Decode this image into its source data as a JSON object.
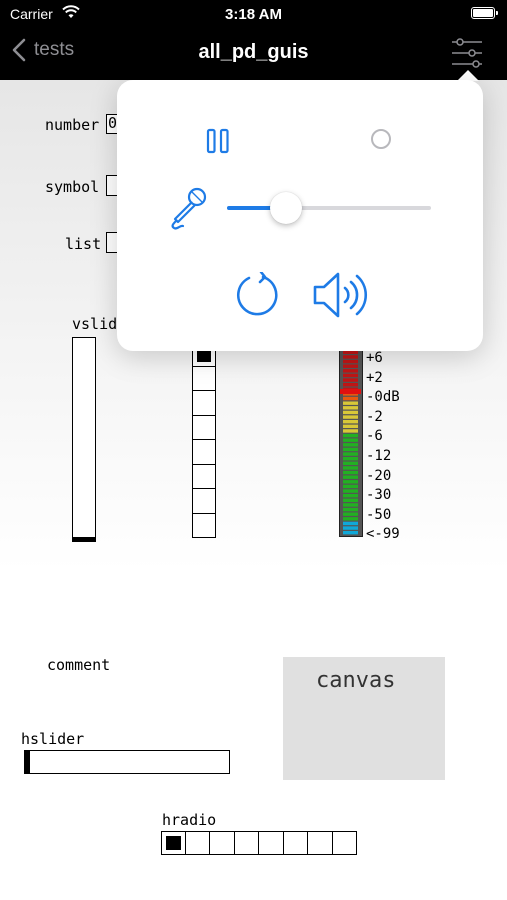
{
  "status": {
    "carrier": "Carrier",
    "time": "3:18 AM",
    "battery_level": 1.0
  },
  "nav": {
    "back_label": "tests",
    "title": "all_pd_guis",
    "settings_icon": "sliders-icon"
  },
  "patch": {
    "number_label": "number",
    "number_value": "0",
    "symbol_label": "symbol",
    "list_label": "list",
    "vslider_label": "vslider",
    "vslider_value": 0.0,
    "vradio_cells": 8,
    "vradio_selected": 0,
    "vu_ticks": [
      "+6",
      "+2",
      "-0dB",
      "-2",
      "-6",
      "-12",
      "-20",
      "-30",
      "-50",
      "<-99"
    ],
    "comment_label": "comment",
    "canvas_label": "canvas",
    "hslider_label": "hslider",
    "hslider_value": 0.0,
    "hradio_label": "hradio",
    "hradio_cells": 8,
    "hradio_selected": 0
  },
  "popover": {
    "pause_icon": "pause-icon",
    "record_icon": "record-circle-icon",
    "mic_icon": "microphone-icon",
    "input_volume": 0.29,
    "reload_icon": "reload-icon",
    "speaker_icon": "speaker-icon",
    "accent_color": "#1e7be6"
  }
}
